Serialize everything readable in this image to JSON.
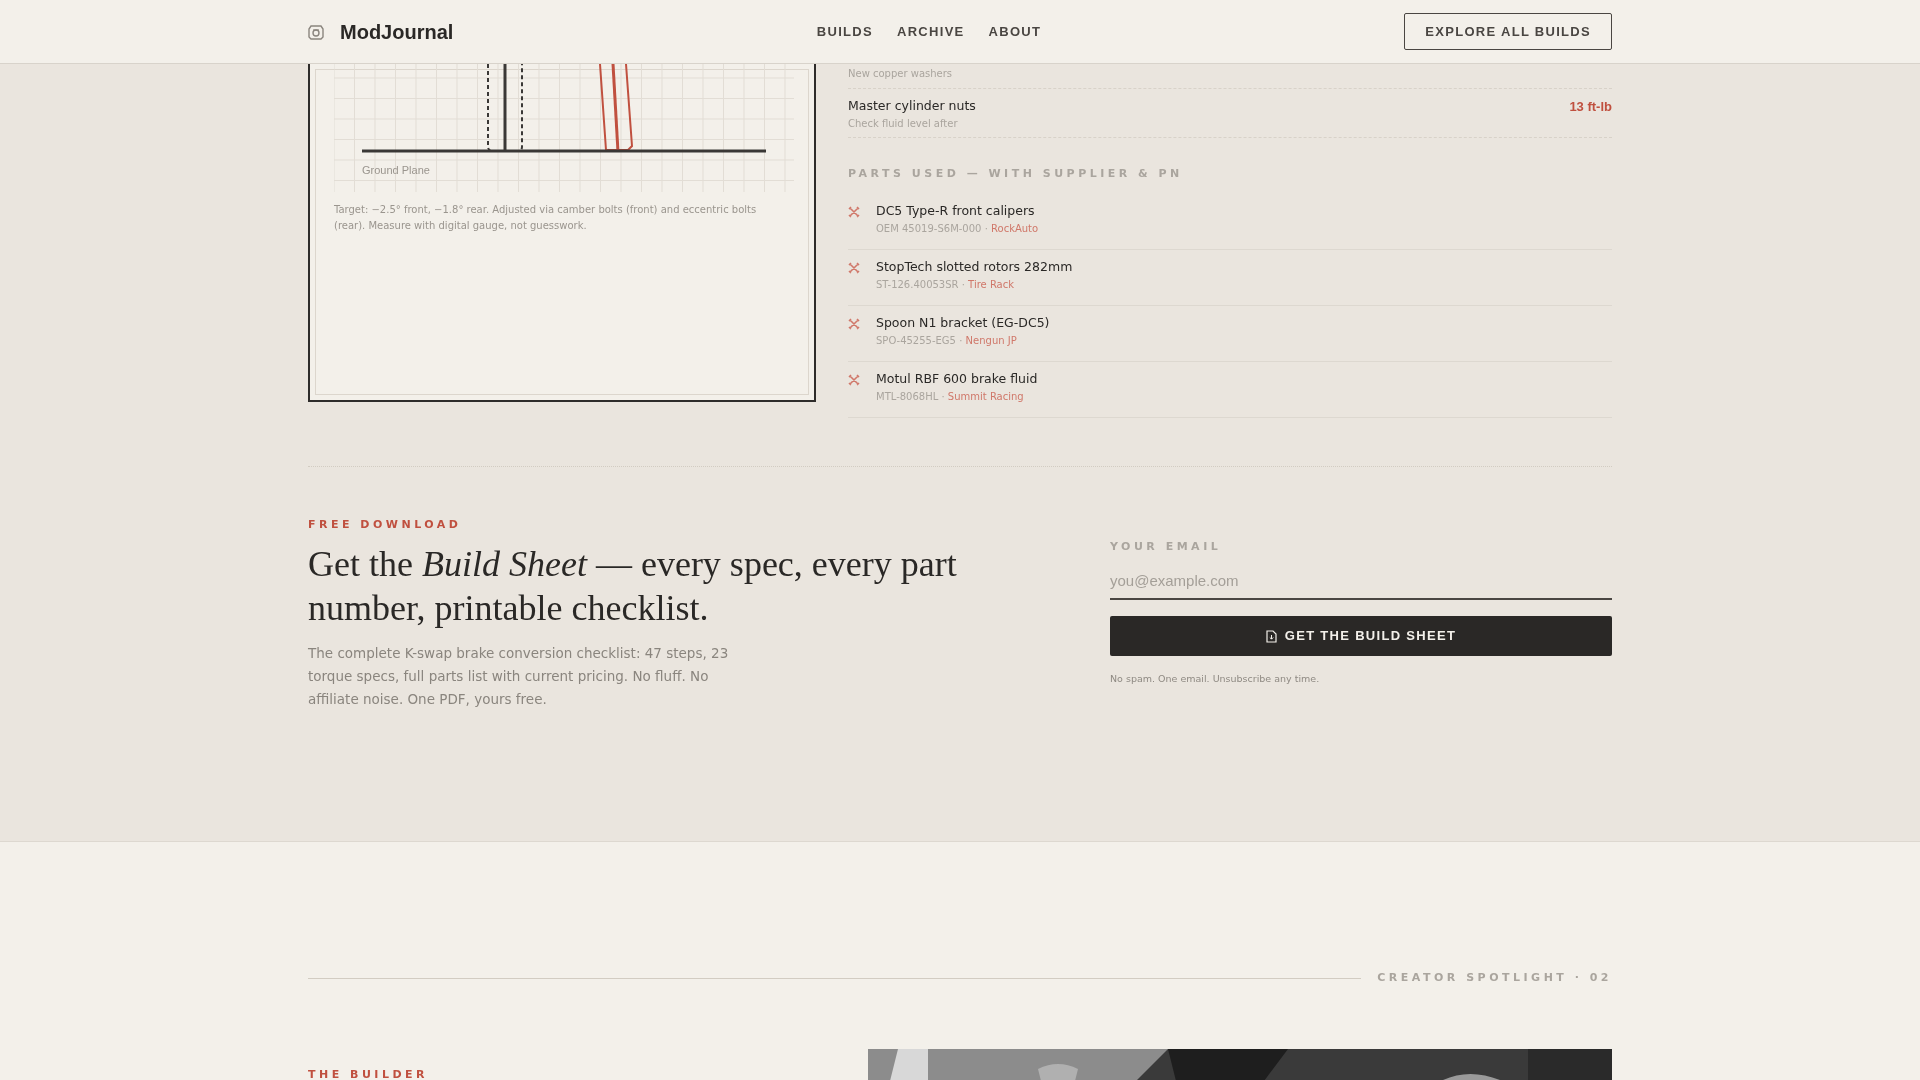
{
  "brand": {
    "name": "ModJournal"
  },
  "nav": [
    {
      "label": "BUILDS"
    },
    {
      "label": "ARCHIVE"
    },
    {
      "label": "ABOUT"
    }
  ],
  "nav_button": "EXPLORE ALL BUILDS",
  "diagram": {
    "ground_label": "Ground Plane",
    "caption": "Target: −2.5° front, −1.8° rear. Adjusted via camber bolts (front) and eccentric bolts (rear). Measure with digital gauge, not guesswork."
  },
  "torque_specs": [
    {
      "note": "New copper washers"
    },
    {
      "name": "Master cylinder nuts",
      "note": "Check fluid level after",
      "value": "13 ft-lb"
    }
  ],
  "parts": {
    "heading": "PARTS USED — WITH SUPPLIER & PN",
    "items": [
      {
        "name": "DC5 Type-R front calipers",
        "pn": "OEM 45019-S6M-000",
        "separator": "·",
        "supplier": "RockAuto"
      },
      {
        "name": "StopTech slotted rotors 282mm",
        "pn": "ST-126.40053SR",
        "separator": "·",
        "supplier": "Tire Rack"
      },
      {
        "name": "Spoon N1 bracket (EG-DC5)",
        "pn": "SPO-45255-EG5",
        "separator": "·",
        "supplier": "Nengun JP"
      },
      {
        "name": "Motul RBF 600 brake fluid",
        "pn": "MTL-8068HL",
        "separator": "·",
        "supplier": "Summit Racing"
      }
    ]
  },
  "download": {
    "eyebrow": "FREE DOWNLOAD",
    "headline": "Get the *Build Sheet* — every spec, every part number, printable checklist.",
    "text": "The complete K-swap brake conversion checklist: 47 steps, 23 torque specs, full parts list with current pricing. No fluff. No affiliate noise. One PDF, yours free.",
    "email_label": "YOUR EMAIL",
    "placeholder": "you@example.com",
    "button": "GET THE BUILD SHEET",
    "note": "No spam. One email. Unsubscribe any time."
  },
  "spotlight": {
    "label": "CREATOR SPOTLIGHT · 02",
    "eyebrow": "THE BUILDER"
  }
}
